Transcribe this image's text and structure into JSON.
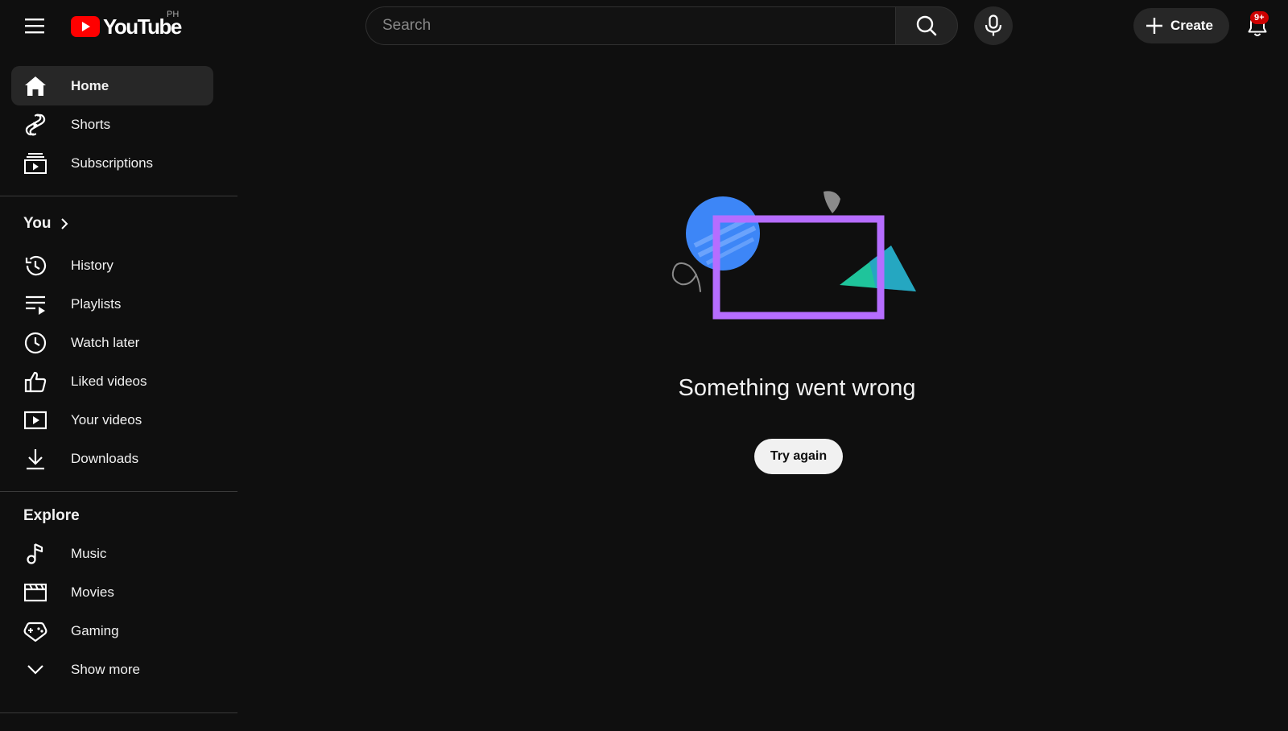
{
  "header": {
    "logo_text": "YouTube",
    "country_code": "PH",
    "search_placeholder": "Search",
    "create_label": "Create",
    "notification_count": "9+"
  },
  "sidebar": {
    "main": [
      {
        "label": "Home",
        "icon": "home-icon",
        "active": true
      },
      {
        "label": "Shorts",
        "icon": "shorts-icon"
      },
      {
        "label": "Subscriptions",
        "icon": "subscriptions-icon"
      }
    ],
    "you_section": {
      "title": "You",
      "items": [
        {
          "label": "History",
          "icon": "history-icon"
        },
        {
          "label": "Playlists",
          "icon": "playlists-icon"
        },
        {
          "label": "Watch later",
          "icon": "watch-later-icon"
        },
        {
          "label": "Liked videos",
          "icon": "thumbs-up-icon"
        },
        {
          "label": "Your videos",
          "icon": "your-videos-icon"
        },
        {
          "label": "Downloads",
          "icon": "download-icon"
        }
      ]
    },
    "explore_section": {
      "title": "Explore",
      "items": [
        {
          "label": "Music",
          "icon": "music-note-icon"
        },
        {
          "label": "Movies",
          "icon": "clapperboard-icon"
        },
        {
          "label": "Gaming",
          "icon": "gamepad-icon"
        },
        {
          "label": "Show more",
          "icon": "chevron-down-icon"
        }
      ]
    }
  },
  "main": {
    "error_message": "Something went wrong",
    "retry_label": "Try again"
  },
  "colors": {
    "background": "#0f0f0f",
    "brand_red": "#ff0000",
    "illustration_purple": "#b66dff",
    "illustration_blue": "#3d86f7",
    "illustration_teal": "#1fc49b"
  }
}
